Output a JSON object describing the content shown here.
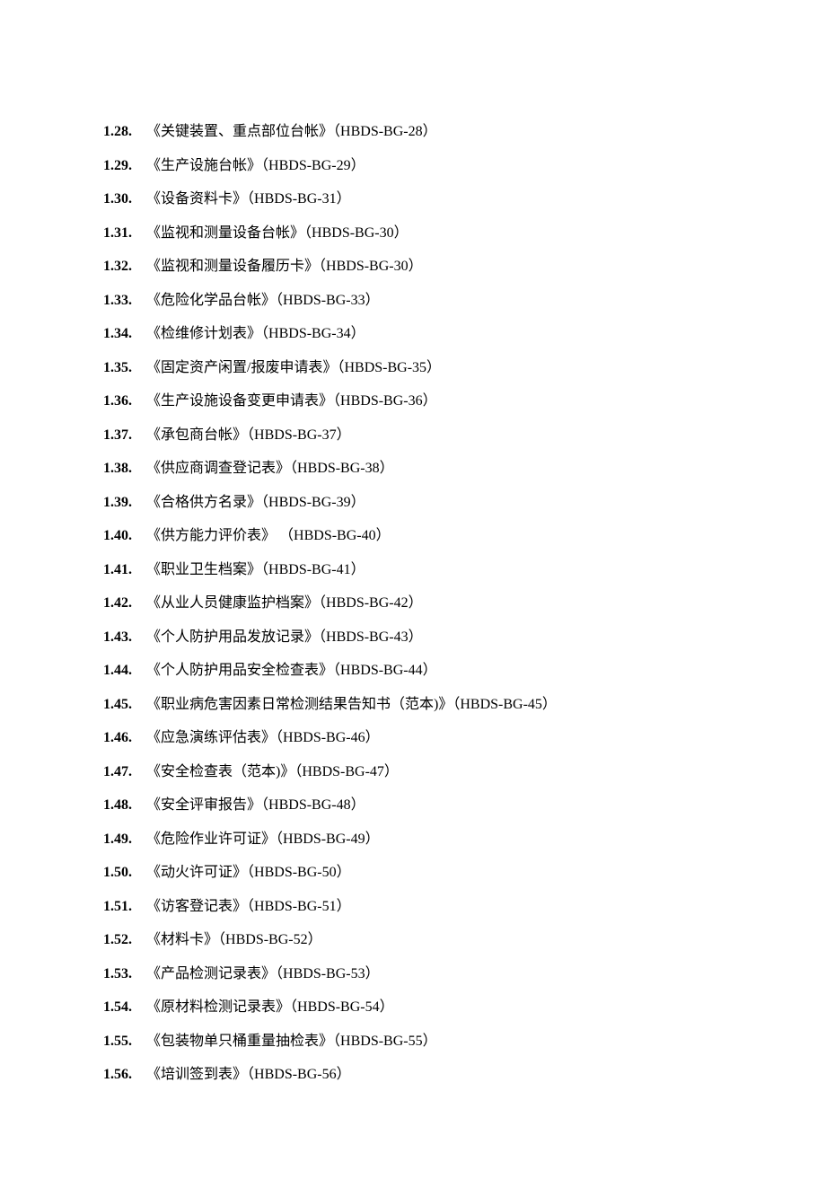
{
  "items": [
    {
      "number": "1.28.",
      "title": "《关键装置、重点部位台帐》",
      "code": "HBDS-BG-28"
    },
    {
      "number": "1.29.",
      "title": "《生产设施台帐》",
      "code": "HBDS-BG-29"
    },
    {
      "number": "1.30.",
      "title": "《设备资料卡》",
      "code": "HBDS-BG-31"
    },
    {
      "number": "1.31.",
      "title": "《监视和测量设备台帐》",
      "code": "HBDS-BG-30"
    },
    {
      "number": "1.32.",
      "title": "《监视和测量设备履历卡》",
      "code": "HBDS-BG-30"
    },
    {
      "number": "1.33.",
      "title": "《危险化学品台帐》",
      "code": "HBDS-BG-33"
    },
    {
      "number": "1.34.",
      "title": "《检维修计划表》",
      "code": "HBDS-BG-34"
    },
    {
      "number": "1.35.",
      "title": "《固定资产闲置/报废申请表》",
      "code": "HBDS-BG-35"
    },
    {
      "number": "1.36.",
      "title": "《生产设施设备变更申请表》",
      "code": "HBDS-BG-36"
    },
    {
      "number": "1.37.",
      "title": "《承包商台帐》",
      "code": "HBDS-BG-37"
    },
    {
      "number": "1.38.",
      "title": "《供应商调查登记表》",
      "code": "HBDS-BG-38"
    },
    {
      "number": "1.39.",
      "title": "《合格供方名录》",
      "code": "HBDS-BG-39"
    },
    {
      "number": "1.40.",
      "title": "《供方能力评价表》 ",
      "code": "HBDS-BG-40"
    },
    {
      "number": "1.41.",
      "title": "《职业卫生档案》",
      "code": "HBDS-BG-41"
    },
    {
      "number": "1.42.",
      "title": "《从业人员健康监护档案》",
      "code": "HBDS-BG-42"
    },
    {
      "number": "1.43.",
      "title": "《个人防护用品发放记录》",
      "code": "HBDS-BG-43"
    },
    {
      "number": "1.44.",
      "title": "《个人防护用品安全检查表》",
      "code": "HBDS-BG-44"
    },
    {
      "number": "1.45.",
      "title": "《职业病危害因素日常检测结果告知书（范本)》",
      "code": "HBDS-BG-45"
    },
    {
      "number": "1.46.",
      "title": "《应急演练评估表》",
      "code": "HBDS-BG-46"
    },
    {
      "number": "1.47.",
      "title": "《安全检查表（范本)》",
      "code": "HBDS-BG-47"
    },
    {
      "number": "1.48.",
      "title": "《安全评审报告》",
      "code": "HBDS-BG-48"
    },
    {
      "number": "1.49.",
      "title": "《危险作业许可证》",
      "code": "HBDS-BG-49"
    },
    {
      "number": "1.50.",
      "title": "《动火许可证》",
      "code": "HBDS-BG-50"
    },
    {
      "number": "1.51.",
      "title": "《访客登记表》",
      "code": "HBDS-BG-51"
    },
    {
      "number": "1.52.",
      "title": "《材料卡》",
      "code": "HBDS-BG-52"
    },
    {
      "number": "1.53.",
      "title": "《产品检测记录表》",
      "code": "HBDS-BG-53"
    },
    {
      "number": "1.54.",
      "title": "《原材料检测记录表》",
      "code": "HBDS-BG-54"
    },
    {
      "number": "1.55.",
      "title": "《包装物单只桶重量抽检表》",
      "code": "HBDS-BG-55"
    },
    {
      "number": "1.56.",
      "title": "《培训签到表》",
      "code": "HBDS-BG-56"
    }
  ]
}
